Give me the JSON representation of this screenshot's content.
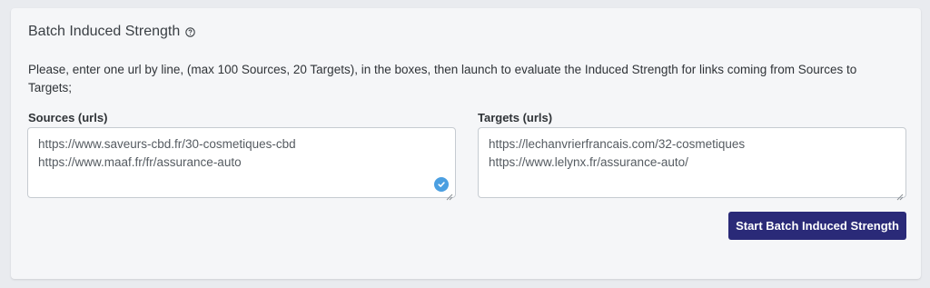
{
  "panel": {
    "title": "Batch Induced Strength",
    "description": "Please, enter one url by line, (max 100 Sources, 20 Targets), in the boxes, then launch to evaluate the Induced Strength for links coming from Sources to Targets;"
  },
  "sources": {
    "label": "Sources (urls)",
    "lines": [
      "https://www.saveurs-cbd.fr/30-cosmetiques-cbd",
      "https://www.maaf.fr/fr/assurance-auto"
    ]
  },
  "targets": {
    "label": "Targets (urls)",
    "lines": [
      "https://lechanvrierfrancais.com/32-cosmetiques",
      "https://www.lelynx.fr/assurance-auto/"
    ]
  },
  "actions": {
    "start_label": "Start Batch Induced Strength"
  },
  "colors": {
    "button_bg": "#2a2a78",
    "check_badge": "#4b9fe1"
  },
  "icons": {
    "help": "question-circle-icon",
    "check": "check-circle-icon",
    "resize": "resize-handle-icon"
  }
}
